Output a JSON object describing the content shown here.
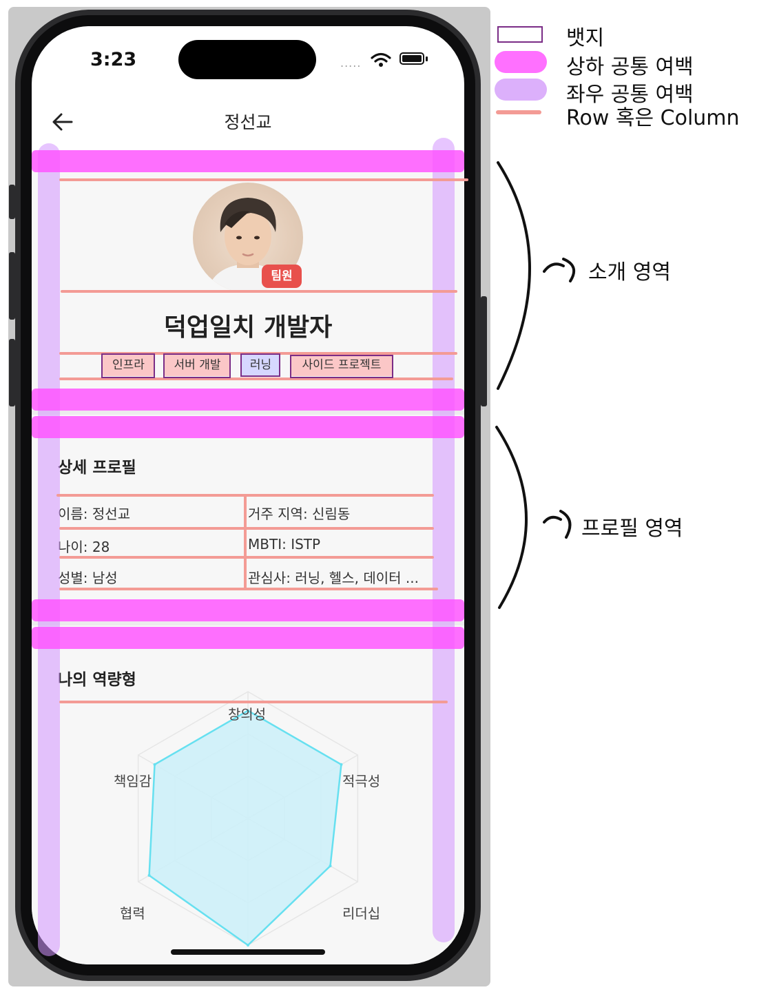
{
  "status_bar": {
    "time": "3:23",
    "signal_dots": "....."
  },
  "app_bar": {
    "title": "정선교"
  },
  "intro": {
    "role_badge": "팀원",
    "job_title": "덕업일치 개발자",
    "tags": [
      "인프라",
      "서버 개발",
      "러닝",
      "사이드 프로젝트"
    ]
  },
  "profile": {
    "title": "상세 프로필",
    "rows": [
      {
        "left": "이름: 정선교",
        "right": "거주 지역: 신림동"
      },
      {
        "left": "나이: 28",
        "right": "MBTI: ISTP"
      },
      {
        "left": "성별: 남성",
        "right": "관심사: 러닝, 헬스, 데이터 ..."
      }
    ]
  },
  "competency": {
    "title": "나의 역량형",
    "chart_data": {
      "type": "radar",
      "categories": [
        "창의성",
        "적극성",
        "리더십",
        "??",
        "협력",
        "책임감"
      ],
      "values": [
        0.85,
        0.85,
        0.75,
        1.0,
        0.9,
        0.85
      ],
      "max": 1.0,
      "rings": 3,
      "colors": {
        "fill": "#cdeff8",
        "stroke": "#66e0f0",
        "grid": "#e6e6e6"
      }
    }
  },
  "legend": [
    {
      "label": "뱃지",
      "kind": "badge-outline",
      "color": "#7a2c86"
    },
    {
      "label": "상하 공통 여백",
      "kind": "vertical-margin",
      "color": "#ff70ff"
    },
    {
      "label": "좌우 공통 여백",
      "kind": "horizontal-margin",
      "color": "#dcb0fb"
    },
    {
      "label": "Row 혹은 Column",
      "kind": "row-column-line",
      "color": "#f39b95"
    }
  ],
  "annotations": {
    "intro_region": "소개 영역",
    "profile_region": "프로필 영역"
  },
  "icons": [
    "back-arrow-icon",
    "wifi-icon",
    "battery-icon",
    "curly-brace-icon",
    "curl-arrow-icon"
  ]
}
